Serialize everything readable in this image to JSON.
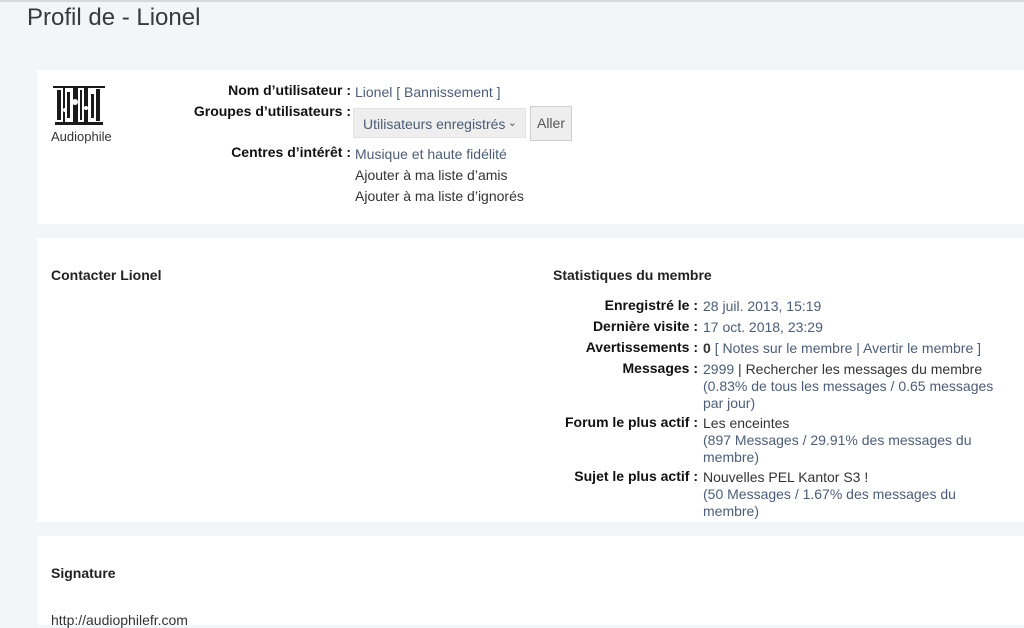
{
  "page_title": "Profil de - Lionel",
  "profile": {
    "rank": "Audiophile",
    "username_label": "Nom d’utilisateur :",
    "username": "Lionel",
    "ban_link": "[ Bannissement ]",
    "groups_label": "Groupes d’utilisateurs :",
    "group_selected": "Utilisateurs enregistrés",
    "go_button": "Aller",
    "interests_label": "Centres d’intérêt :",
    "interests": "Musique et haute fidélité",
    "add_friend": "Ajouter à ma liste d’amis",
    "add_foe": "Ajouter à ma liste d’ignorés"
  },
  "contact": {
    "title": "Contacter Lionel"
  },
  "stats": {
    "title": "Statistiques du membre",
    "registered_label": "Enregistré le :",
    "registered": "28 juil. 2013, 15:19",
    "last_visit_label": "Dernière visite :",
    "last_visit": "17 oct. 2018, 23:29",
    "warnings_label": "Avertissements :",
    "warnings_count": "0",
    "warnings_links": "[ Notes sur le membre | Avertir le membre ]",
    "posts_label": "Messages :",
    "posts_count": "2999",
    "posts_search": "| Rechercher les messages du membre",
    "posts_detail": "(0.83% de tous les messages / 0.65 messages par jour)",
    "active_forum_label": "Forum le plus actif :",
    "active_forum": "Les enceintes",
    "active_forum_detail": "(897 Messages / 29.91% des messages du membre)",
    "active_topic_label": "Sujet le plus actif :",
    "active_topic": "Nouvelles PEL Kantor S3 !",
    "active_topic_detail": "(50 Messages / 1.67% des messages du membre)"
  },
  "signature": {
    "title": "Signature",
    "text": "http://audiophilefr.com"
  }
}
